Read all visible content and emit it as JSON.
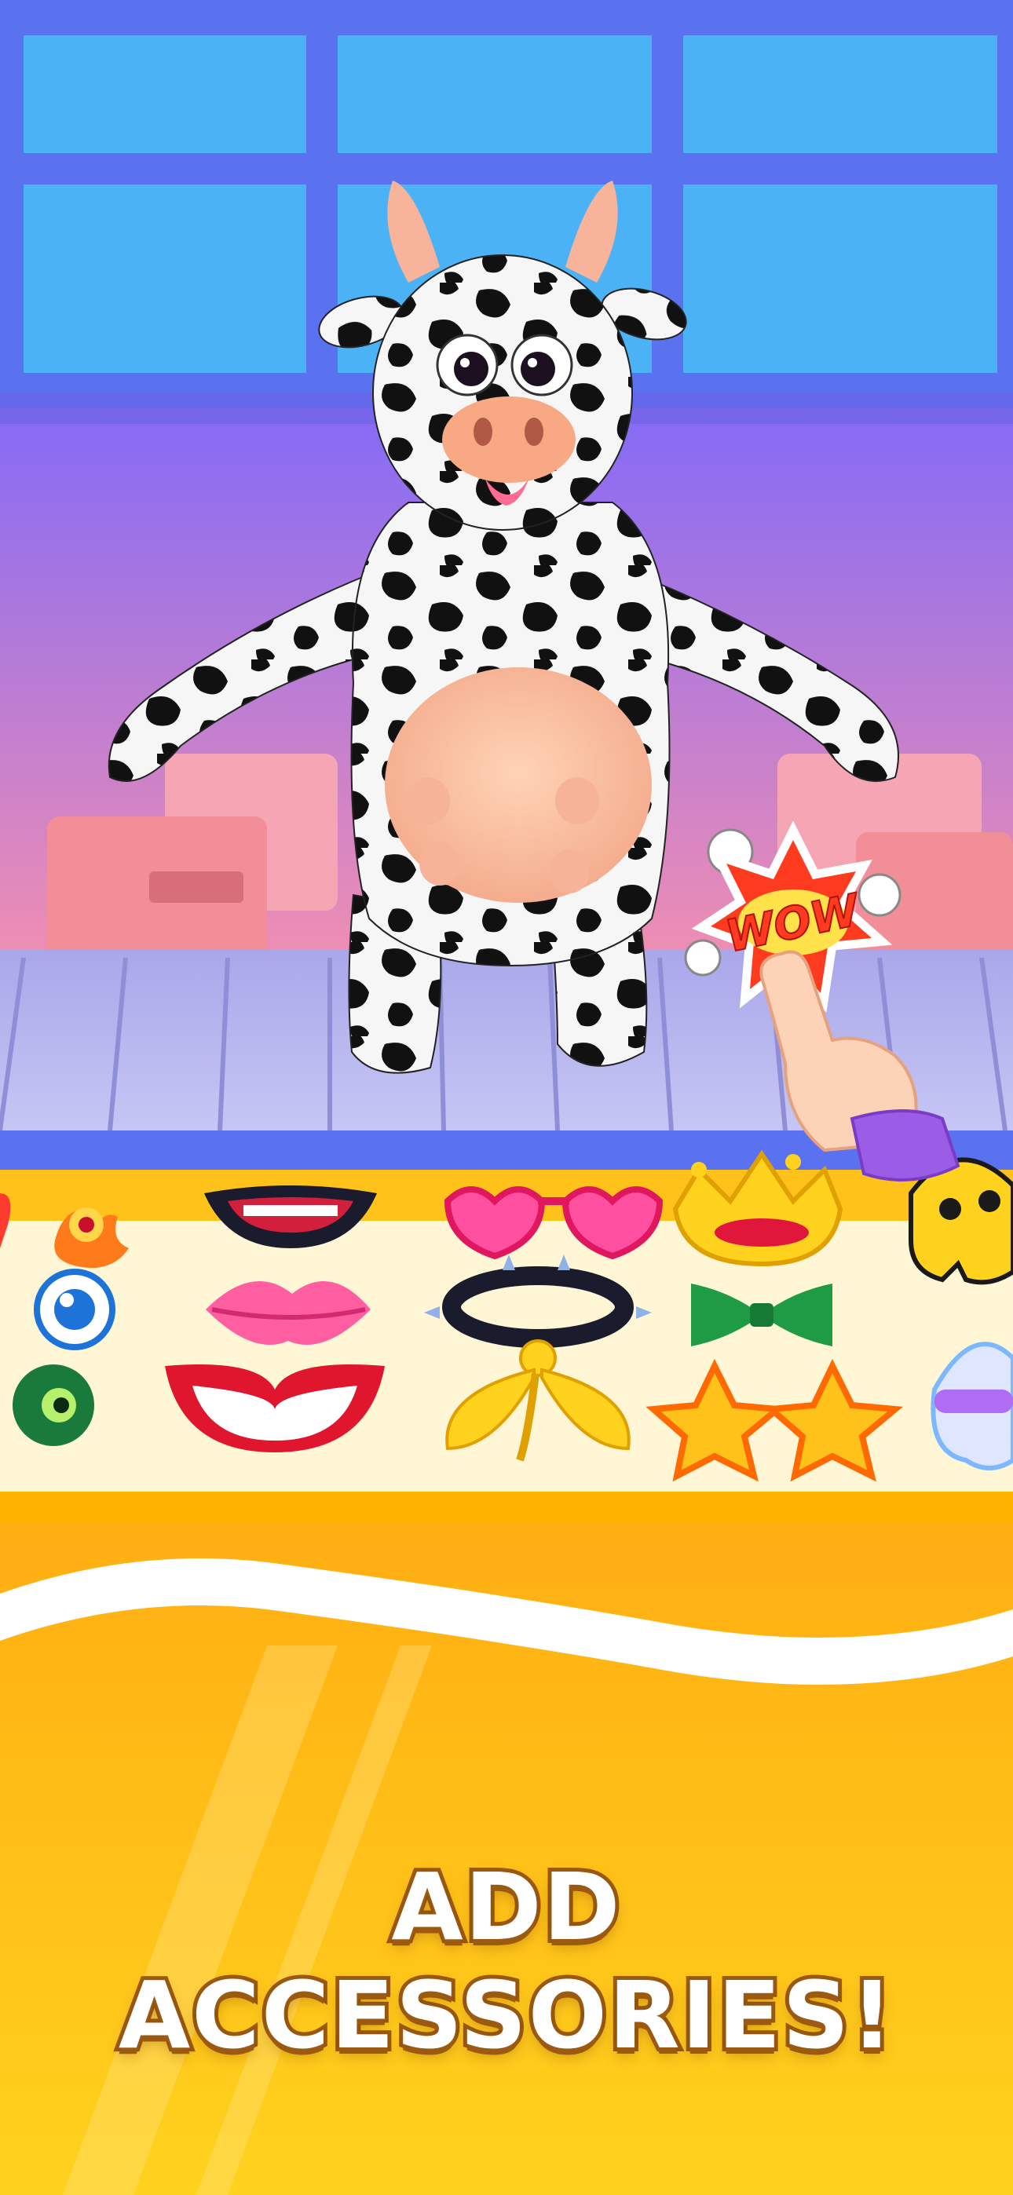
{
  "caption": "ADD ACCESSORIES!",
  "sticker": {
    "label": "WOW"
  },
  "colors": {
    "wall_top": "#4f6ff0",
    "wall_bottom": "#b06cf5",
    "window_glass": "#4fb3f7",
    "window_frame": "#5578ef",
    "belt": "#b8b9f0",
    "tray": "#ffc21a",
    "tray_inner": "#fff6d6",
    "banner": "#ffb300",
    "caption_outline": "#9b5a10"
  },
  "accessories": [
    "flame-eye-icon",
    "mouth-teeth-icon",
    "heart-glasses-icon",
    "crown-icon",
    "skull-icon",
    "blue-eye-icon",
    "pink-lips-icon",
    "spiked-collar-icon",
    "bow-tie-icon",
    "green-eye-icon",
    "red-lips-teeth-icon",
    "yellow-ribbon-icon",
    "star-glasses-icon",
    "skull-glasses-icon"
  ]
}
